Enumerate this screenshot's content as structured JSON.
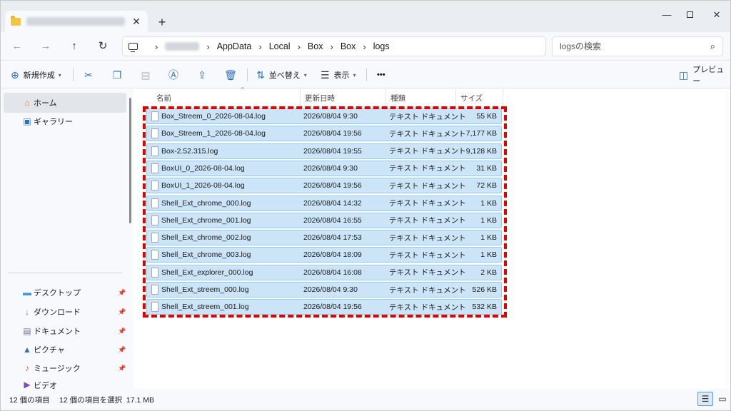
{
  "window": {
    "tab_close": "✕",
    "new_tab": "+",
    "controls": {
      "minimize": "—",
      "close": "✕"
    }
  },
  "address": {
    "crumbs": [
      "AppData",
      "Local",
      "Box",
      "Box",
      "logs"
    ],
    "search_placeholder": "logsの検索"
  },
  "toolbar": {
    "new_label": "新規作成",
    "sort_label": "並べ替え",
    "view_label": "表示",
    "more_label": "•••",
    "preview_label": "プレビュー"
  },
  "sidebar": {
    "items": [
      {
        "label": "ホーム",
        "icon": "home-icon"
      },
      {
        "label": "ギャラリー",
        "icon": "gallery-icon"
      },
      {
        "label": "デスクトップ",
        "icon": "desktop-icon"
      },
      {
        "label": "ダウンロード",
        "icon": "download-icon"
      },
      {
        "label": "ドキュメント",
        "icon": "document-icon"
      },
      {
        "label": "ピクチャ",
        "icon": "pictures-icon"
      },
      {
        "label": "ミュージック",
        "icon": "music-icon"
      },
      {
        "label": "ビデオ",
        "icon": "video-icon"
      }
    ]
  },
  "columns": {
    "name": "名前",
    "date": "更新日時",
    "type": "種類",
    "size": "サイズ"
  },
  "files": [
    {
      "name": "Box_Streem_0_2026-08-04.log",
      "date": "2026/08/04 9:30",
      "type": "テキスト ドキュメント",
      "size": "55 KB"
    },
    {
      "name": "Box_Streem_1_2026-08-04.log",
      "date": "2026/08/04 19:56",
      "type": "テキスト ドキュメント",
      "size": "7,177 KB"
    },
    {
      "name": "Box-2.52.315.log",
      "date": "2026/08/04 19:55",
      "type": "テキスト ドキュメント",
      "size": "9,128 KB"
    },
    {
      "name": "BoxUI_0_2026-08-04.log",
      "date": "2026/08/04 9:30",
      "type": "テキスト ドキュメント",
      "size": "31 KB"
    },
    {
      "name": "BoxUI_1_2026-08-04.log",
      "date": "2026/08/04 19:56",
      "type": "テキスト ドキュメント",
      "size": "72 KB"
    },
    {
      "name": "Shell_Ext_chrome_000.log",
      "date": "2026/08/04 14:32",
      "type": "テキスト ドキュメント",
      "size": "1 KB"
    },
    {
      "name": "Shell_Ext_chrome_001.log",
      "date": "2026/08/04 16:55",
      "type": "テキスト ドキュメント",
      "size": "1 KB"
    },
    {
      "name": "Shell_Ext_chrome_002.log",
      "date": "2026/08/04 17:53",
      "type": "テキスト ドキュメント",
      "size": "1 KB"
    },
    {
      "name": "Shell_Ext_chrome_003.log",
      "date": "2026/08/04 18:09",
      "type": "テキスト ドキュメント",
      "size": "1 KB"
    },
    {
      "name": "Shell_Ext_explorer_000.log",
      "date": "2026/08/04 16:08",
      "type": "テキスト ドキュメント",
      "size": "2 KB"
    },
    {
      "name": "Shell_Ext_streem_000.log",
      "date": "2026/08/04 9:30",
      "type": "テキスト ドキュメント",
      "size": "526 KB"
    },
    {
      "name": "Shell_Ext_streem_001.log",
      "date": "2026/08/04 19:56",
      "type": "テキスト ドキュメント",
      "size": "532 KB"
    }
  ],
  "status": {
    "item_count": "12 個の項目",
    "selection": "12 個の項目を選択  17.1 MB"
  },
  "colors": {
    "selection_bg": "#cce4f7",
    "selection_border": "#99c9ef",
    "highlight": "#e00000",
    "accent": "#2c6fc0"
  }
}
